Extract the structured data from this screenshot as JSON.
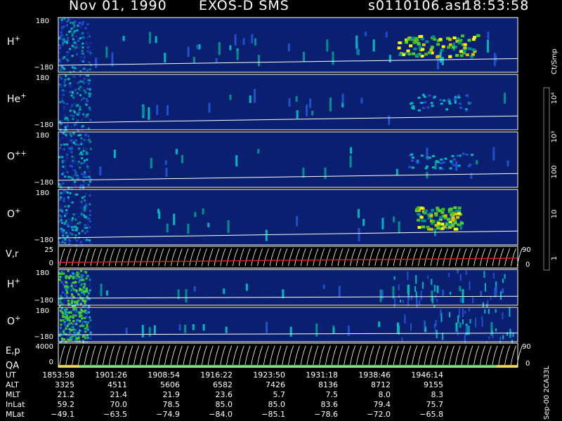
{
  "header": {
    "date": "Nov 01, 1990",
    "instrument": "EXOS-D SMS",
    "file": "s0110106.asr",
    "time": "18:53:58"
  },
  "colorbar": {
    "unit": "Ct/Smp",
    "tick_labels": [
      "10⁴",
      "10³",
      "100",
      "10",
      "1"
    ],
    "colors": [
      "#ffffff",
      "#7a1010",
      "#a01010",
      "#c00000",
      "#e00000",
      "#ff1010",
      "#6b5a10",
      "#8a8010",
      "#b0a010",
      "#d0c000",
      "#ffff00",
      "#30a010",
      "#40c020",
      "#50d030",
      "#009090",
      "#00b8c0",
      "#2050d0",
      "#1030a0",
      "#0a1f70"
    ]
  },
  "sidebar_right": "Sep-00  2CA33L",
  "chart_data": [
    {
      "type": "heatmap",
      "panels": [
        {
          "label": "H",
          "superscript": "+",
          "y_top": "180",
          "y_bottom": "−180"
        },
        {
          "label": "He",
          "superscript": "+",
          "y_top": "180",
          "y_bottom": "−180"
        },
        {
          "label": "O",
          "superscript": "++",
          "y_top": "180",
          "y_bottom": "−180"
        },
        {
          "label": "O",
          "superscript": "+",
          "y_top": "180",
          "y_bottom": "−180"
        }
      ]
    },
    {
      "type": "line",
      "label": "V,r",
      "y_top": "25",
      "y_bottom": "0",
      "right_top": "90",
      "right_bottom": "0"
    },
    {
      "type": "heatmap",
      "panels": [
        {
          "label": "H",
          "superscript": "+",
          "y_top": "180",
          "y_bottom": "−180"
        },
        {
          "label": "O",
          "superscript": "+",
          "y_top": "180",
          "y_bottom": "−180"
        }
      ]
    },
    {
      "type": "line",
      "label": "E,p",
      "label2": "QA",
      "y_top": "4000",
      "y_bottom": "0",
      "right_top": "90",
      "right_bottom": "0"
    }
  ],
  "footer": {
    "rows": [
      {
        "label": "UT",
        "values": [
          "1853:58",
          "1901:26",
          "1908:54",
          "1916:22",
          "1923:50",
          "1931:18",
          "1938:46",
          "1946:14"
        ]
      },
      {
        "label": "ALT",
        "values": [
          "3325",
          "4511",
          "5606",
          "6582",
          "7426",
          "8136",
          "8712",
          "9155"
        ]
      },
      {
        "label": "MLT",
        "values": [
          "21.2",
          "21.4",
          "21.9",
          "23.6",
          "5.7",
          "7.5",
          "8.0",
          "8.3"
        ]
      },
      {
        "label": "InLat",
        "values": [
          "59.2",
          "70.0",
          "78.5",
          "85.0",
          "85.0",
          "83.6",
          "79.4",
          "75.7"
        ]
      },
      {
        "label": "MLat",
        "values": [
          "−49.1",
          "−63.5",
          "−74.9",
          "−84.0",
          "−85.1",
          "−78.6",
          "−72.0",
          "−65.8"
        ]
      }
    ]
  }
}
